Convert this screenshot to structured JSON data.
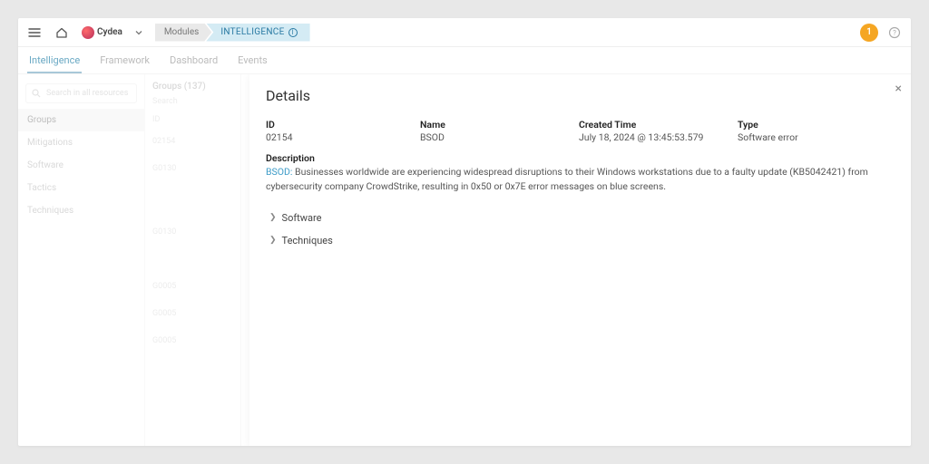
{
  "topbar": {
    "logo_text": "Cydea",
    "crumb_modules": "Modules",
    "crumb_intel": "INTELLIGENCE",
    "avatar_initial": "1"
  },
  "tabs": {
    "items": [
      "Intelligence",
      "Framework",
      "Dashboard",
      "Events"
    ],
    "active": 0
  },
  "sidebar": {
    "search_placeholder": "Search in all resources",
    "categories": [
      "Groups",
      "Mitigations",
      "Software",
      "Tactics",
      "Techniques"
    ],
    "active_category": 0,
    "groups_header": "Groups (137)",
    "groups_search_placeholder": "Search",
    "groups_id_col": "ID",
    "groups_items": [
      "02154",
      "G0130",
      "G0130",
      "G0005",
      "G0005",
      "G0005"
    ]
  },
  "details": {
    "title": "Details",
    "fields": {
      "id_label": "ID",
      "id_value": "02154",
      "name_label": "Name",
      "name_value": "BSOD",
      "time_label": "Created Time",
      "time_value": "July 18, 2024 @ 13:45:53.579",
      "type_label": "Type",
      "type_value": "Software error"
    },
    "description_label": "Description",
    "description_link": "BSOD:",
    "description_text": "Businesses worldwide are experiencing widespread disruptions to their Windows workstations due to a faulty update (KB5042421) from cybersecurity company CrowdStrike, resulting in 0x50 or 0x7E error messages on blue screens.",
    "accordion": [
      "Software",
      "Techniques"
    ]
  }
}
